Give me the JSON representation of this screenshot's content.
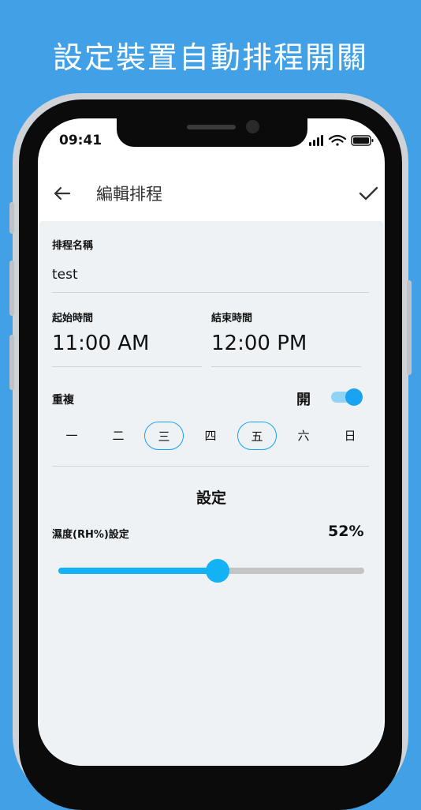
{
  "headline": "設定裝置自動排程開關",
  "status_bar": {
    "time": "09:41"
  },
  "app_bar": {
    "title": "編輯排程",
    "back_icon": "arrow-left-icon",
    "confirm_icon": "check-icon"
  },
  "schedule_name": {
    "label": "排程名稱",
    "value": "test"
  },
  "start_time": {
    "label": "起始時間",
    "value": "11:00 AM"
  },
  "end_time": {
    "label": "結束時間",
    "value": "12:00 PM"
  },
  "repeat": {
    "label": "重複",
    "toggle_label": "開",
    "enabled": true,
    "days": [
      {
        "label": "一",
        "selected": false
      },
      {
        "label": "二",
        "selected": false
      },
      {
        "label": "三",
        "selected": true
      },
      {
        "label": "四",
        "selected": false
      },
      {
        "label": "五",
        "selected": true
      },
      {
        "label": "六",
        "selected": false
      },
      {
        "label": "日",
        "selected": false
      }
    ]
  },
  "settings": {
    "title": "設定",
    "humidity_label": "濕度(RH%)設定",
    "humidity_value": "52%",
    "humidity_level": 0.52
  },
  "colors": {
    "background": "#41a0e6",
    "accent": "#13b2f5",
    "panel": "#eff2f4",
    "slider_track": "#c4c4c4"
  }
}
